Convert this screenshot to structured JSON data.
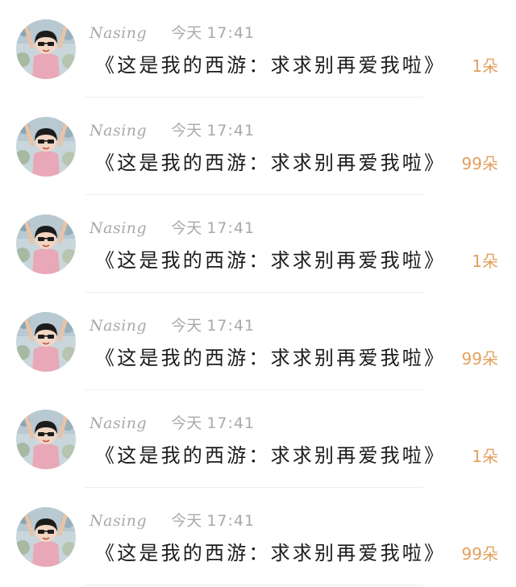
{
  "list": {
    "items": [
      {
        "author": "Nasing",
        "date": "今天",
        "time": "17:41",
        "title": "《这是我的西游：求求别再爱我啦》",
        "count": "1朵"
      },
      {
        "author": "Nasing",
        "date": "今天",
        "time": "17:41",
        "title": "《这是我的西游：求求别再爱我啦》",
        "count": "99朵"
      },
      {
        "author": "Nasing",
        "date": "今天",
        "time": "17:41",
        "title": "《这是我的西游：求求别再爱我啦》",
        "count": "1朵"
      },
      {
        "author": "Nasing",
        "date": "今天",
        "time": "17:41",
        "title": "《这是我的西游：求求别再爱我啦》",
        "count": "99朵"
      },
      {
        "author": "Nasing",
        "date": "今天",
        "time": "17:41",
        "title": "《这是我的西游：求求别再爱我啦》",
        "count": "1朵"
      },
      {
        "author": "Nasing",
        "date": "今天",
        "time": "17:41",
        "title": "《这是我的西游：求求别再爱我啦》",
        "count": "99朵"
      }
    ]
  },
  "colors": {
    "meta_text": "#a9a9a9",
    "title_text": "#1b1b1b",
    "count_accent": "#e3a05e",
    "divider": "#eeeeee"
  },
  "icons": {
    "avatar": "user-avatar-image"
  }
}
